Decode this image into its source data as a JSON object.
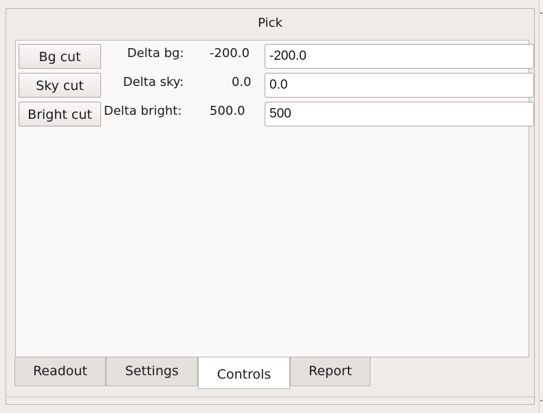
{
  "pane": {
    "title": "Pick"
  },
  "controls": {
    "rows": [
      {
        "button": "Bg cut",
        "label": "Delta bg:",
        "value": "-200.0",
        "input": "-200.0"
      },
      {
        "button": "Sky cut",
        "label": "Delta sky:",
        "value": "0.0",
        "input": "0.0"
      },
      {
        "button": "Bright cut",
        "label": "Delta bright:",
        "value": "500.0",
        "input": "500"
      }
    ]
  },
  "tabs": [
    {
      "label": "Readout",
      "active": false
    },
    {
      "label": "Settings",
      "active": false
    },
    {
      "label": "Controls",
      "active": true
    },
    {
      "label": "Report",
      "active": false
    }
  ],
  "colors": {
    "background": "#efebe7",
    "content": "#fbf9f8",
    "active_tab": "#ffffff"
  }
}
